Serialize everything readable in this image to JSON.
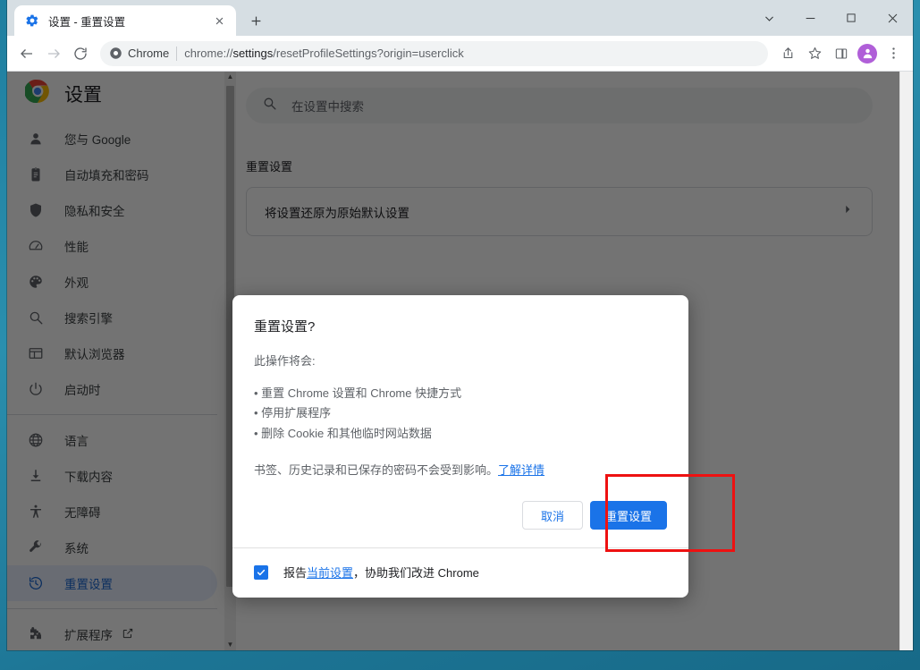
{
  "window": {
    "controls": [
      {
        "name": "tab-search",
        "glyph": "⌄"
      },
      {
        "name": "minimize",
        "glyph": "—"
      },
      {
        "name": "maximize",
        "glyph": "▢"
      },
      {
        "name": "close",
        "glyph": "✕"
      }
    ]
  },
  "tab": {
    "title": "设置 - 重置设置",
    "favicon": "gear-icon",
    "close_glyph": "✕",
    "new_tab_glyph": "+"
  },
  "toolbar": {
    "back_glyph": "←",
    "forward_glyph": "→",
    "reload_glyph": "⟳",
    "chip_label": "Chrome",
    "url_prefix": "chrome://",
    "url_bold": "settings",
    "url_suffix": "/resetProfileSettings?origin=userclick",
    "url_full": "chrome://settings/resetProfileSettings?origin=userclick",
    "share_glyph": "share-icon",
    "bookmark_glyph": "☆",
    "sidepanel_glyph": "side-panel-icon",
    "avatar_glyph": "profile-avatar",
    "menu_glyph": "⋮"
  },
  "settings": {
    "brand_title": "设置",
    "search": {
      "placeholder": "在设置中搜索",
      "value": "",
      "icon": "search-icon"
    },
    "section_title": "重置设置",
    "card": {
      "label": "将设置还原为原始默认设置",
      "arrow": "▸"
    },
    "sidebar": [
      {
        "label": "您与 Google",
        "icon": "person-icon",
        "selected": false
      },
      {
        "label": "自动填充和密码",
        "icon": "clipboard-icon",
        "selected": false
      },
      {
        "label": "隐私和安全",
        "icon": "shield-icon",
        "selected": false
      },
      {
        "label": "性能",
        "icon": "speedometer-icon",
        "selected": false
      },
      {
        "label": "外观",
        "icon": "palette-icon",
        "selected": false
      },
      {
        "label": "搜索引擎",
        "icon": "search-icon",
        "selected": false
      },
      {
        "label": "默认浏览器",
        "icon": "browser-window-icon",
        "selected": false
      },
      {
        "label": "启动时",
        "icon": "power-icon",
        "selected": false
      },
      {
        "label": "语言",
        "icon": "globe-icon",
        "selected": false
      },
      {
        "label": "下载内容",
        "icon": "download-icon",
        "selected": false
      },
      {
        "label": "无障碍",
        "icon": "accessibility-icon",
        "selected": false
      },
      {
        "label": "系统",
        "icon": "wrench-icon",
        "selected": false
      },
      {
        "label": "重置设置",
        "icon": "history-reset-icon",
        "selected": true
      }
    ],
    "extensions": {
      "label": "扩展程序",
      "icon": "puzzle-icon",
      "external_icon": "external-link-icon"
    }
  },
  "dialog": {
    "title": "重置设置?",
    "intro": "此操作将会:",
    "bullets": [
      "重置 Chrome 设置和 Chrome 快捷方式",
      "停用扩展程序",
      "删除 Cookie 和其他临时网站数据"
    ],
    "note_text": "书签、历史记录和已保存的密码不会受到影响。",
    "note_link": "了解详情",
    "cancel_label": "取消",
    "confirm_label": "重置设置",
    "checkbox": {
      "checked": true,
      "check_glyph": "✓",
      "text_before": "报告",
      "link": "当前设置",
      "text_after": "，协助我们改进 Chrome"
    }
  },
  "annotation": {
    "highlight_color": "#ee1111",
    "target": "重置设置"
  }
}
